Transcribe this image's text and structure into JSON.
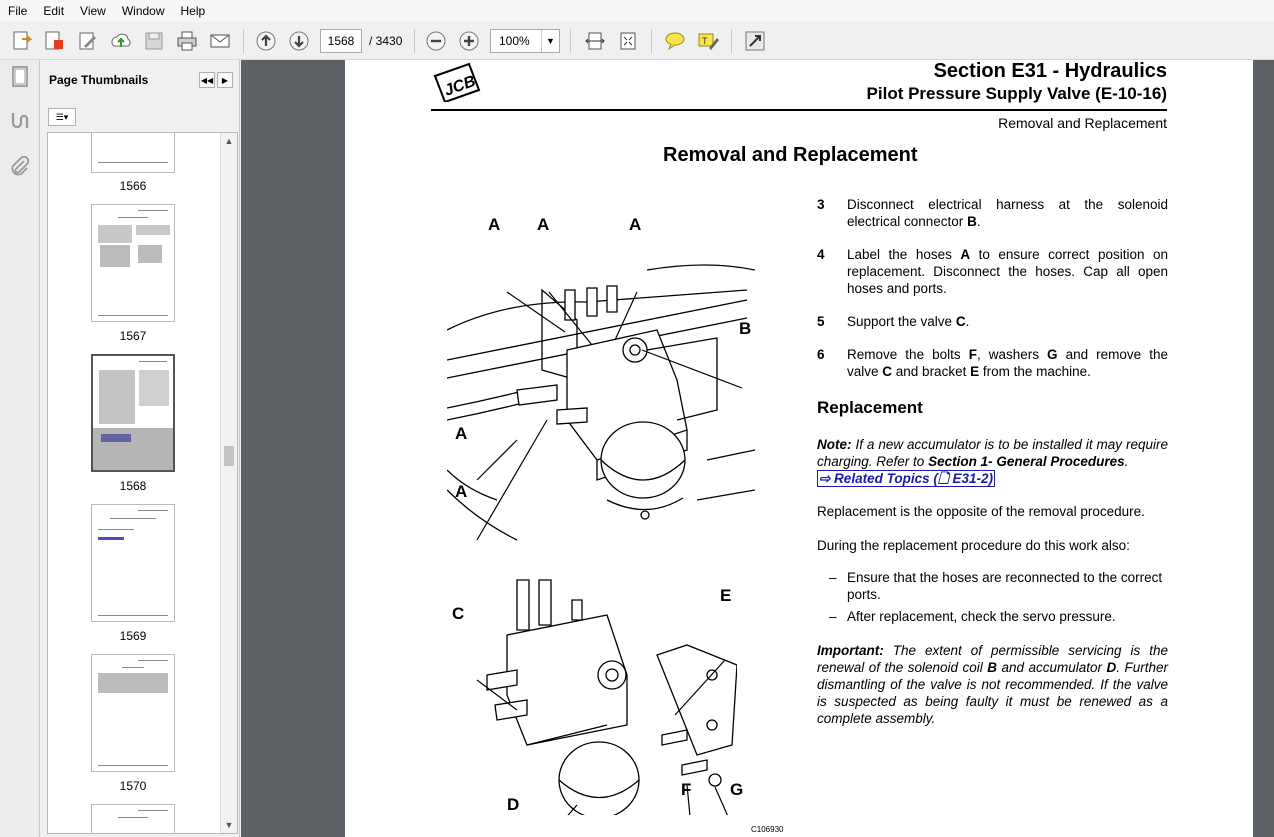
{
  "menu": [
    "File",
    "Edit",
    "View",
    "Window",
    "Help"
  ],
  "toolbar": {
    "current_page": "1568",
    "total_pages": "/ 3430",
    "zoom": "100%",
    "icons": [
      "create-icon",
      "export-icon",
      "edit-icon",
      "upload-icon",
      "save-icon",
      "print-icon",
      "email-icon",
      "prev-page-icon",
      "next-page-icon",
      "zoom-out-icon",
      "zoom-in-icon",
      "fit-width-icon",
      "fit-page-icon",
      "comment-icon",
      "highlight-icon",
      "expand-icon"
    ]
  },
  "panel": {
    "title": "Page Thumbnails",
    "thumbnails": [
      {
        "label": "1566"
      },
      {
        "label": "1567"
      },
      {
        "label": "1568",
        "selected": true
      },
      {
        "label": "1569"
      },
      {
        "label": "1570"
      }
    ]
  },
  "document": {
    "logo": "JCB",
    "section_title": "Section E31 - Hydraulics",
    "section_sub": "Pilot Pressure Supply Valve (E-10-16)",
    "breadcrumb": "Removal and Replacement",
    "heading": "Removal and Replacement",
    "steps": [
      {
        "num": "3",
        "text_parts": [
          "Disconnect electrical harness at the solenoid electrical connector ",
          "B",
          "."
        ]
      },
      {
        "num": "4",
        "text_parts": [
          "Label the hoses ",
          "A",
          " to ensure correct position on replacement. Disconnect the hoses. Cap all open hoses and ports."
        ]
      },
      {
        "num": "5",
        "text_parts": [
          "Support the valve ",
          "C",
          "."
        ]
      },
      {
        "num": "6",
        "text_parts": [
          "Remove the bolts ",
          "F",
          ", washers ",
          "G",
          " and remove the valve ",
          "C",
          " and bracket ",
          "E",
          " from the machine."
        ]
      }
    ],
    "replacement_heading": "Replacement",
    "note_label": "Note:",
    "note_text": " If a new accumulator is to be installed it may require charging. Refer to ",
    "note_ref": "Section 1- General Procedures",
    "note_end": ".",
    "related_topics": "⇨ Related Topics (",
    "related_ref": " E31-2)",
    "para1": "Replacement is the opposite of the removal procedure.",
    "para2": "During the replacement procedure do this work also:",
    "bullets": [
      "Ensure that the hoses are reconnected to the correct ports.",
      "After replacement, check the servo pressure."
    ],
    "important_label": "Important:",
    "important_parts": [
      " The extent of permissible servicing is the renewal of the solenoid coil ",
      "B",
      " and accumulator ",
      "D",
      ". Further dismantling of the valve is not recommended. If the valve is suspected as being faulty it must be renewed as a complete assembly."
    ],
    "figure_code": "C106930",
    "figure1_labels": [
      "A",
      "A",
      "A",
      "B",
      "A",
      "A"
    ],
    "figure2_labels": [
      "C",
      "E",
      "D",
      "F",
      "G"
    ]
  }
}
